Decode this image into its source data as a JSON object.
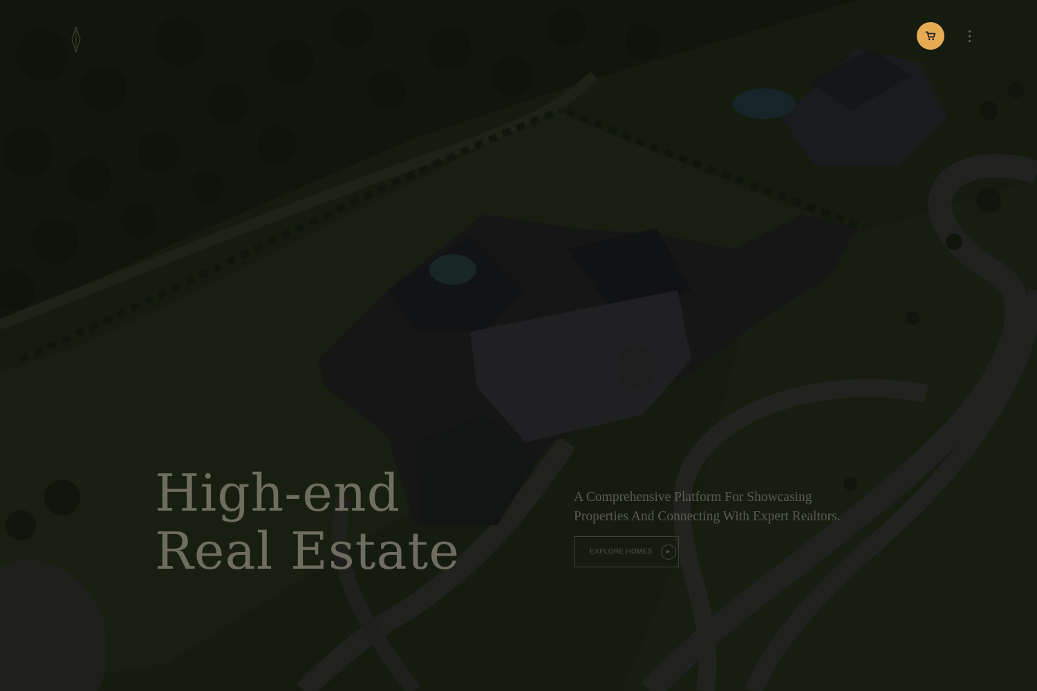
{
  "theme": {
    "accent": "#e6ac54",
    "cart_icon_color": "#2a241a"
  },
  "header": {
    "logo_icon": "diamond-logo-icon",
    "cart_icon": "cart-icon",
    "menu_icon": "vertical-dots-icon"
  },
  "hero": {
    "headline": [
      "High-end",
      "Real Estate"
    ],
    "tagline": [
      "A Comprehensive Platform For Showcasing",
      "Properties And Connecting With Expert Realtors."
    ],
    "cta_label": "EXPLORE HOMES",
    "cta_icon": "arrow-right-icon",
    "background": "aerial-estate-photo"
  }
}
